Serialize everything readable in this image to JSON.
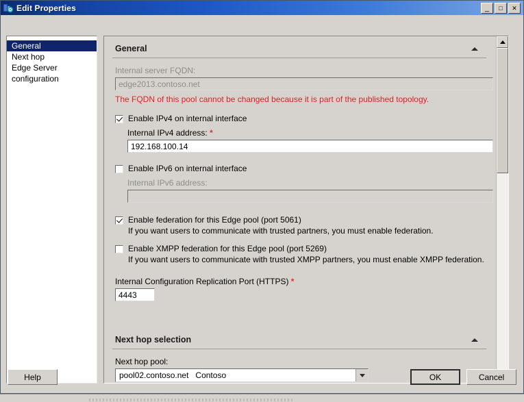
{
  "window": {
    "title": "Edit Properties",
    "icon": "lync-topology-icon",
    "controls": {
      "minimize": "_",
      "maximize": "□",
      "close": "✕"
    }
  },
  "sidebar": {
    "items": [
      {
        "label": "General",
        "selected": true
      },
      {
        "label": "Next hop",
        "selected": false
      },
      {
        "label": "Edge Server configuration",
        "selected": false
      }
    ]
  },
  "sections": {
    "general": {
      "title": "General",
      "collapse_icon": "chevron-up-icon",
      "fqdn_label": "Internal server FQDN:",
      "fqdn_value": "edge2013.contoso.net",
      "warning": "The FQDN of this pool cannot be changed because it is part of the published topology.",
      "ipv4_checkbox": {
        "label": "Enable IPv4 on internal interface",
        "checked": true
      },
      "ipv4_label": "Internal IPv4 address:",
      "ipv4_required": "*",
      "ipv4_value": "192.168.100.14",
      "ipv6_checkbox": {
        "label": "Enable IPv6 on internal interface",
        "checked": false
      },
      "ipv6_label": "Internal IPv6 address:",
      "ipv6_value": "",
      "federation_checkbox": {
        "label": "Enable federation for this Edge pool (port 5061)",
        "checked": true
      },
      "federation_note": "If you want users to communicate with trusted partners, you must enable federation.",
      "xmpp_checkbox": {
        "label": "Enable XMPP federation for this Edge pool (port 5269)",
        "checked": false
      },
      "xmpp_note": "If you want users to communicate with trusted XMPP partners, you must enable XMPP federation.",
      "repl_port_label": "Internal Configuration Replication Port (HTTPS)",
      "repl_port_required": "*",
      "repl_port_value": "4443"
    },
    "next_hop": {
      "title": "Next hop selection",
      "collapse_icon": "chevron-up-icon",
      "pool_label": "Next hop pool:",
      "pool_value": "pool02.contoso.net   Contoso"
    }
  },
  "scrollbar": {
    "up_icon": "triangle-up-icon",
    "down_icon": "triangle-down-icon"
  },
  "footer": {
    "help": "Help",
    "ok": "OK",
    "cancel": "Cancel"
  },
  "colors": {
    "title_accent": "#1d56c4",
    "selection": "#10246e",
    "warning": "#e02020",
    "required": "#e03030",
    "face": "#d6d3ce"
  }
}
